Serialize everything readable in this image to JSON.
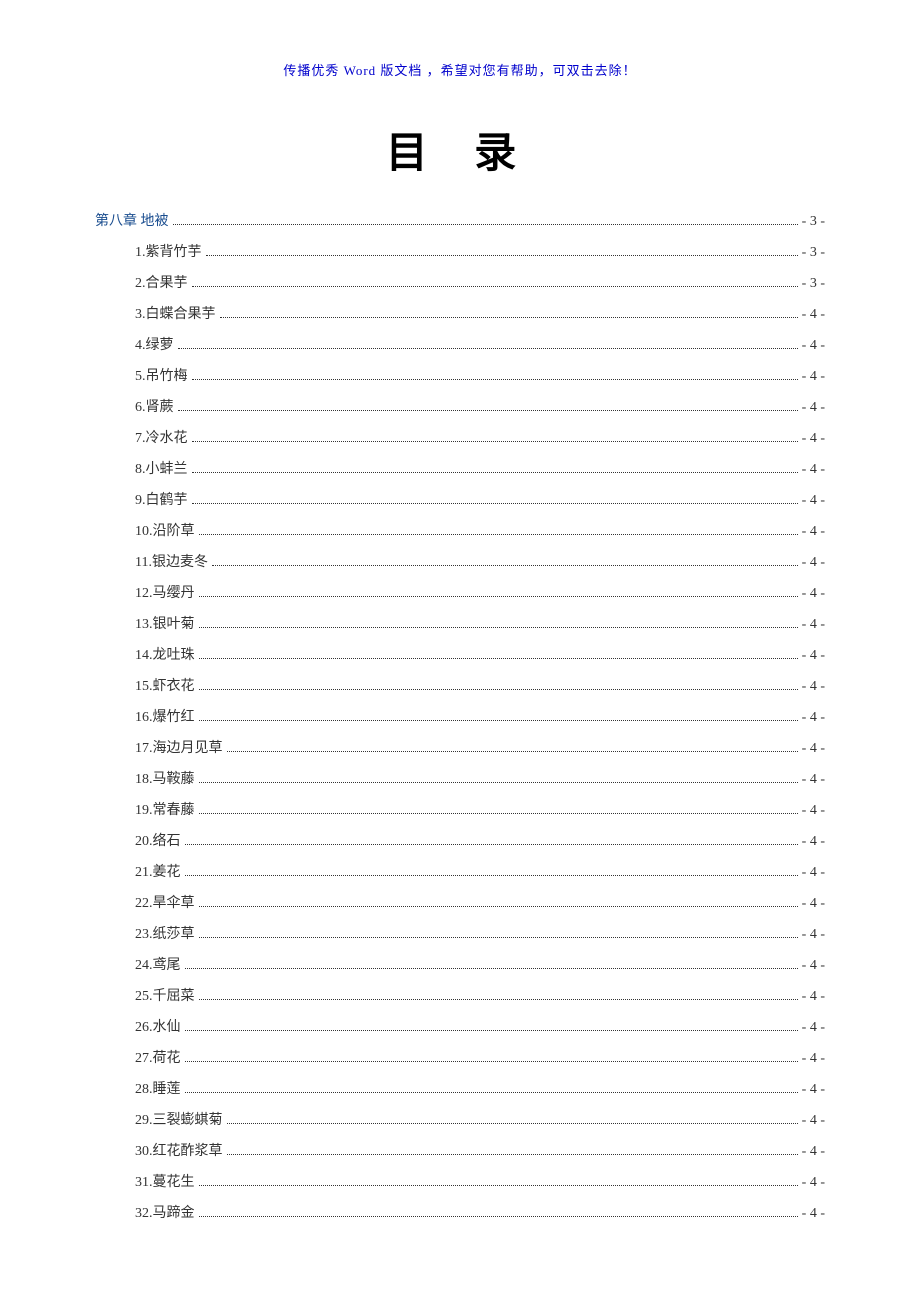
{
  "header_note": "传播优秀 Word 版文档 ，希望对您有帮助，可双击去除！",
  "title": "目 录",
  "toc": {
    "chapter": {
      "label": "第八章 地被",
      "page": "- 3 -"
    },
    "items": [
      {
        "label": "1.紫背竹芋",
        "page": "- 3 -"
      },
      {
        "label": "2.合果芋",
        "page": "- 3 -"
      },
      {
        "label": "3.白蝶合果芋",
        "page": "- 4 -"
      },
      {
        "label": "4.绿萝",
        "page": "- 4 -"
      },
      {
        "label": "5.吊竹梅",
        "page": "- 4 -"
      },
      {
        "label": "6.肾蕨",
        "page": "- 4 -"
      },
      {
        "label": "7.冷水花",
        "page": "- 4 -"
      },
      {
        "label": "8.小蚌兰",
        "page": "- 4 -"
      },
      {
        "label": "9.白鹤芋",
        "page": "- 4 -"
      },
      {
        "label": "10.沿阶草",
        "page": "- 4 -"
      },
      {
        "label": "11.银边麦冬",
        "page": "- 4 -"
      },
      {
        "label": "12.马缨丹",
        "page": "- 4 -"
      },
      {
        "label": "13.银叶菊",
        "page": "- 4 -"
      },
      {
        "label": "14.龙吐珠",
        "page": "- 4 -"
      },
      {
        "label": "15.虾衣花",
        "page": "- 4 -"
      },
      {
        "label": "16.爆竹红",
        "page": "- 4 -"
      },
      {
        "label": "17.海边月见草",
        "page": "- 4 -"
      },
      {
        "label": "18.马鞍藤",
        "page": "- 4 -"
      },
      {
        "label": "19.常春藤",
        "page": "- 4 -"
      },
      {
        "label": "20.络石",
        "page": "- 4 -"
      },
      {
        "label": "21.姜花",
        "page": "- 4 -"
      },
      {
        "label": "22.旱伞草",
        "page": "- 4 -"
      },
      {
        "label": "23.纸莎草",
        "page": "- 4 -"
      },
      {
        "label": "24.鸢尾",
        "page": "- 4 -"
      },
      {
        "label": "25.千屈菜",
        "page": "- 4 -"
      },
      {
        "label": "26.水仙",
        "page": "- 4 -"
      },
      {
        "label": "27.荷花",
        "page": "- 4 -"
      },
      {
        "label": "28.睡莲",
        "page": "- 4 -"
      },
      {
        "label": "29.三裂蟛蜞菊",
        "page": "- 4 -"
      },
      {
        "label": "30.红花酢浆草",
        "page": "- 4 -"
      },
      {
        "label": "31.蔓花生",
        "page": "- 4 -"
      },
      {
        "label": "32.马蹄金",
        "page": "- 4 -"
      }
    ]
  }
}
